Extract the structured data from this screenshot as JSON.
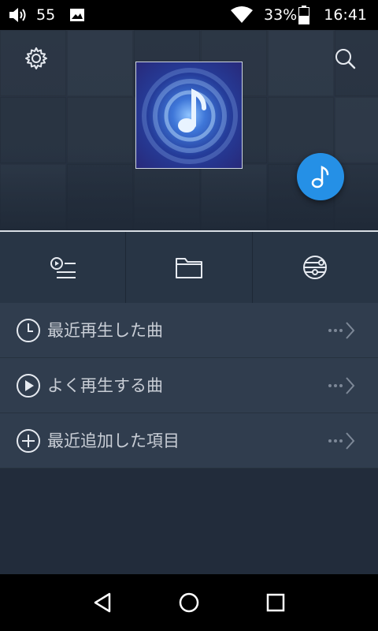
{
  "status_bar": {
    "volume_level": "55",
    "battery_percent": "33%",
    "time": "16:41",
    "icons": [
      "volume-icon",
      "gallery-notification-icon",
      "wifi-icon",
      "battery-icon"
    ]
  },
  "header": {
    "icons": [
      "gear-icon",
      "search-icon",
      "music-note-icon"
    ],
    "accent_color": "#2590e6"
  },
  "toolbar": {
    "icons": [
      "playlist-icon",
      "folder-icon",
      "dlna-network-icon"
    ]
  },
  "list": {
    "items": [
      {
        "label": "最近再生した曲",
        "icon": "clock-icon"
      },
      {
        "label": "よく再生する曲",
        "icon": "play-circle-icon"
      },
      {
        "label": "最近追加した項目",
        "icon": "plus-circle-icon"
      }
    ]
  },
  "nav_bar": {
    "icons": [
      "back-icon",
      "home-icon",
      "recents-icon"
    ]
  }
}
